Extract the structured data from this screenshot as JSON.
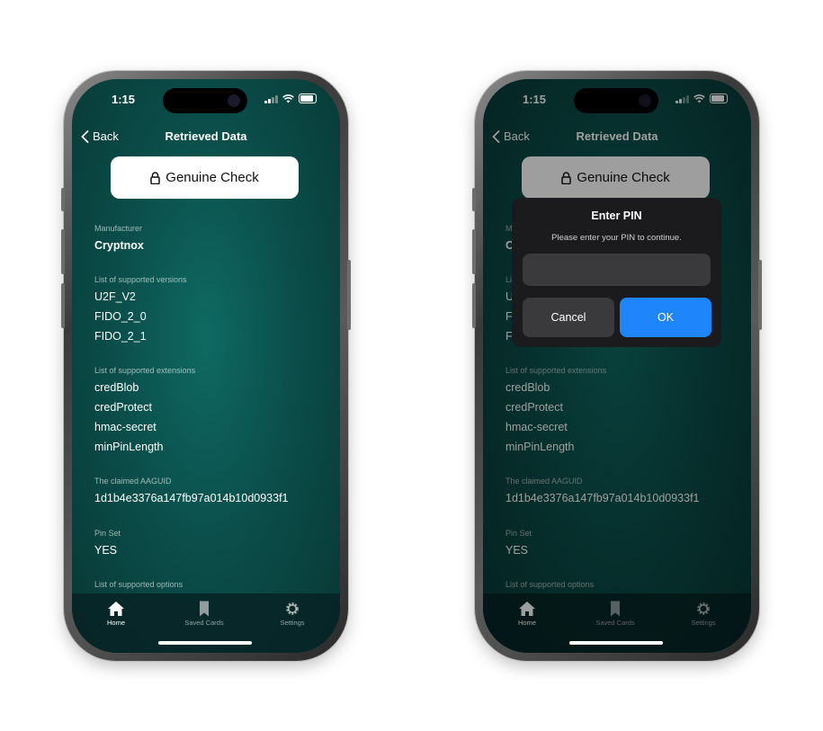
{
  "status": {
    "time": "1:15"
  },
  "nav": {
    "back_label": "Back",
    "title": "Retrieved Data"
  },
  "genuine_check": {
    "label": "Genuine Check"
  },
  "sections": {
    "manufacturer": {
      "label": "Manufacturer",
      "value": "Cryptnox"
    },
    "versions": {
      "label": "List of supported versions",
      "items": [
        "U2F_V2",
        "FIDO_2_0",
        "FIDO_2_1"
      ]
    },
    "extensions": {
      "label": "List of supported extensions",
      "items": [
        "credBlob",
        "credProtect",
        "hmac-secret",
        "minPinLength"
      ]
    },
    "aaguid": {
      "label": "The claimed AAGUID",
      "value": "1d1b4e3376a147fb97a014b10d0933f1"
    },
    "pin_set": {
      "label": "Pin Set",
      "value": "YES"
    },
    "options": {
      "label": "List of supported options"
    }
  },
  "tabs": [
    {
      "label": "Home",
      "icon": "home-icon",
      "active": true
    },
    {
      "label": "Saved Cards",
      "icon": "bookmark-icon",
      "active": false
    },
    {
      "label": "Settings",
      "icon": "gear-icon",
      "active": false
    }
  ],
  "dialog": {
    "title": "Enter PIN",
    "message": "Please enter your PIN to continue.",
    "pin_value": "",
    "cancel_label": "Cancel",
    "ok_label": "OK"
  },
  "colors": {
    "accent": "#1e85fb",
    "background": "#0b4f4b"
  }
}
